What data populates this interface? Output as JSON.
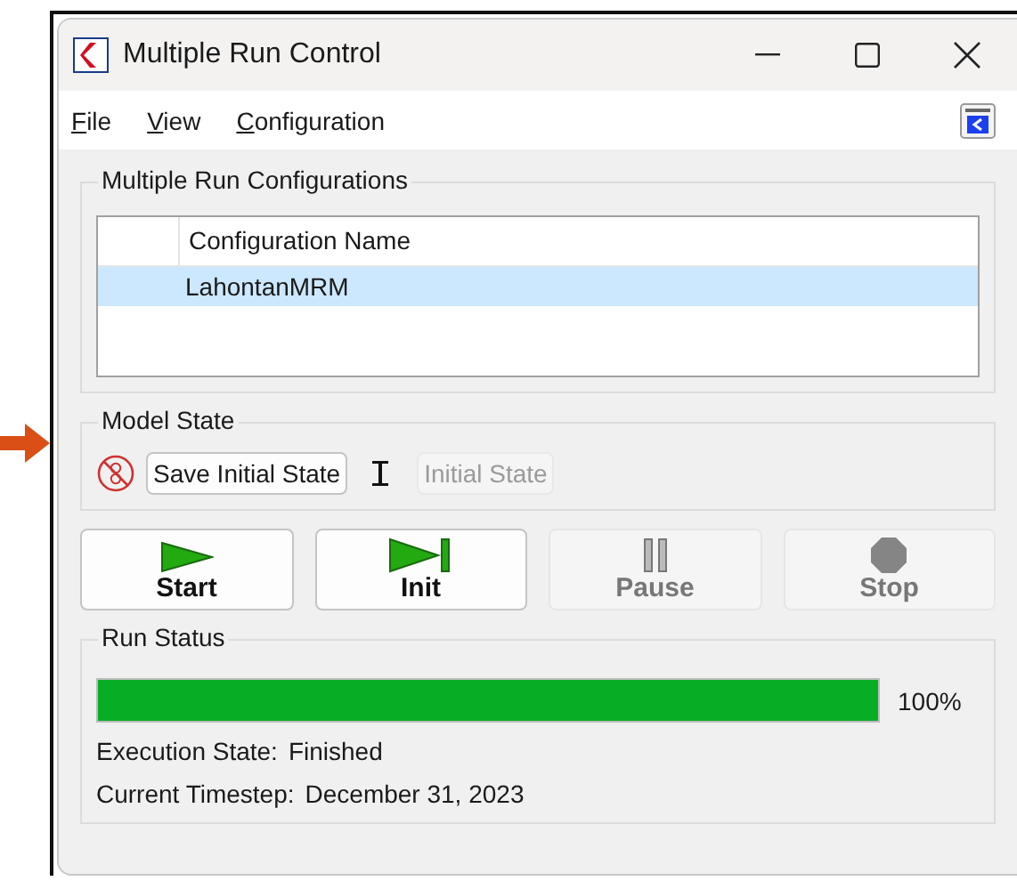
{
  "window": {
    "title": "Multiple Run Control"
  },
  "menu": [
    {
      "label": "File"
    },
    {
      "label": "View"
    },
    {
      "label": "Configuration"
    }
  ],
  "configurations": {
    "title": "Multiple Run Configurations",
    "columns": [
      "Configuration Name"
    ],
    "rows": [
      {
        "name": "LahontanMRM",
        "selected": true
      }
    ]
  },
  "model_state": {
    "title": "Model State",
    "save_button": "Save Initial State",
    "initial_state_button": {
      "label": "Initial State",
      "disabled": true
    }
  },
  "run_buttons": [
    {
      "kind": "start",
      "label": "Start",
      "disabled": false
    },
    {
      "kind": "init",
      "label": "Init",
      "disabled": false
    },
    {
      "kind": "pause",
      "label": "Pause",
      "disabled": true
    },
    {
      "kind": "stop",
      "label": "Stop",
      "disabled": true
    }
  ],
  "run_status": {
    "title": "Run Status",
    "level": 1,
    "reading": "100%",
    "fields": [
      {
        "label": "Execution State:",
        "value": "Finished"
      },
      {
        "label": "Current Timestep:",
        "value": "December 31, 2023"
      }
    ]
  }
}
